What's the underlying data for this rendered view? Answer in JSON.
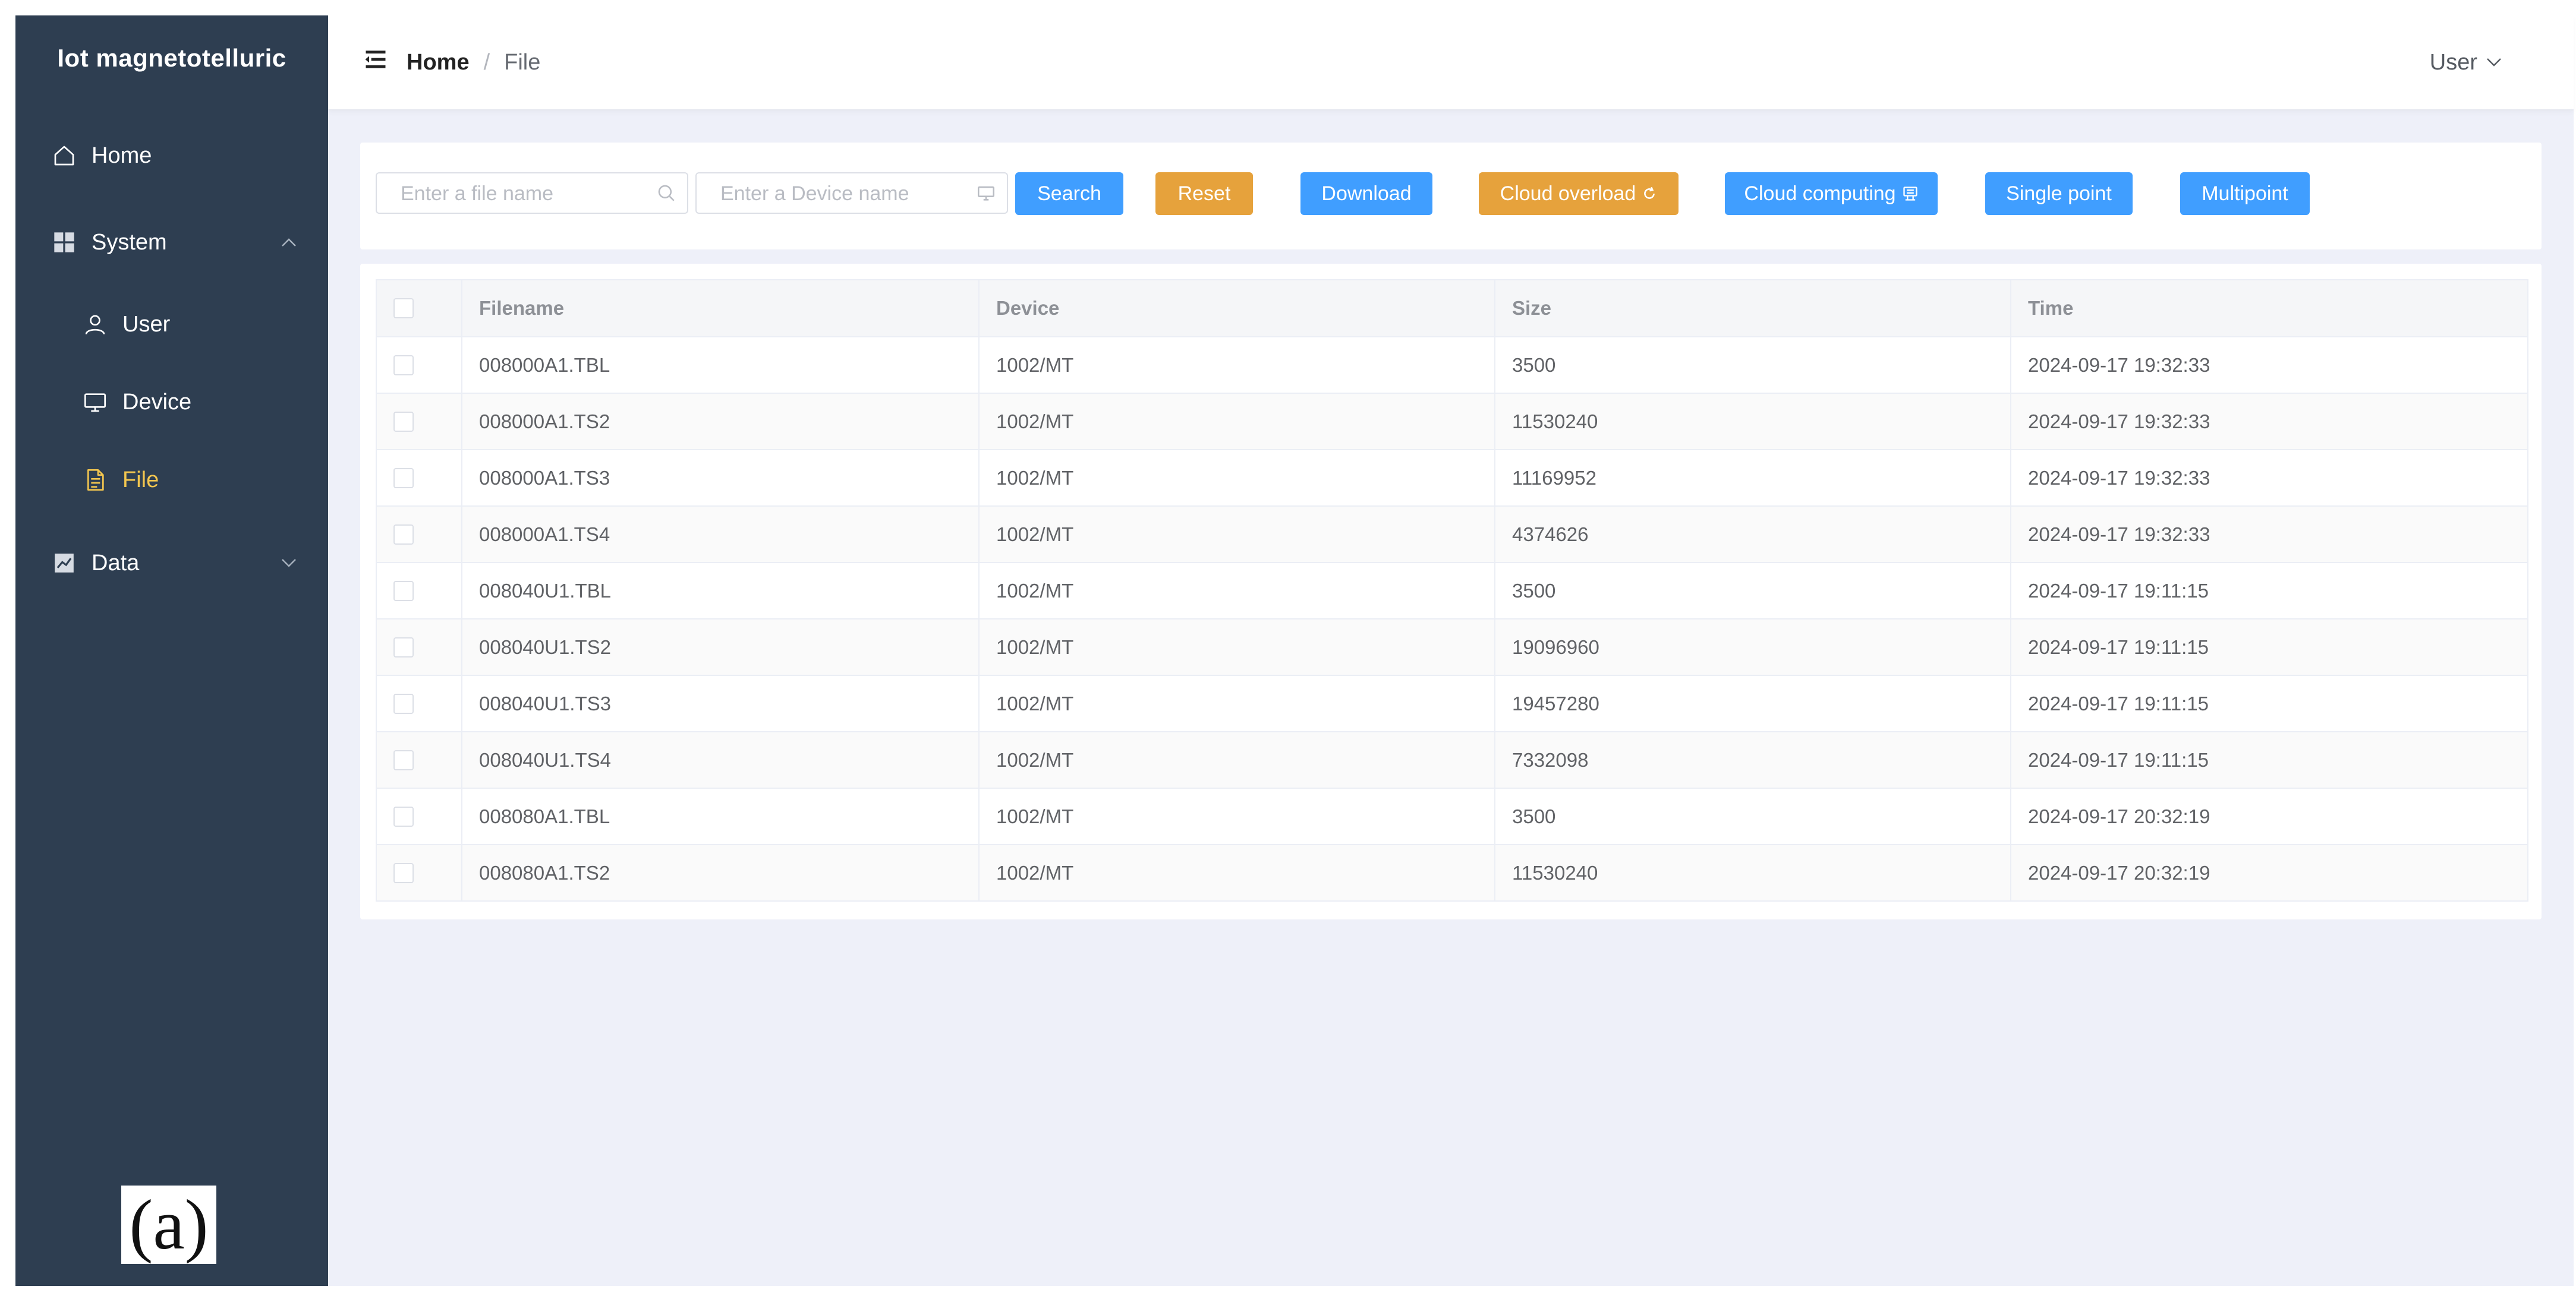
{
  "app": {
    "title": "Iot magnetotelluric"
  },
  "sidebar": {
    "items": [
      {
        "label": "Home",
        "icon": "home-icon"
      },
      {
        "label": "System",
        "icon": "grid-icon",
        "expanded": true
      },
      {
        "label": "User",
        "icon": "user-icon"
      },
      {
        "label": "Device",
        "icon": "monitor-icon"
      },
      {
        "label": "File",
        "icon": "document-icon",
        "active": true
      },
      {
        "label": "Data",
        "icon": "chart-icon",
        "expanded": false
      }
    ],
    "figure_label": "(a)"
  },
  "header": {
    "breadcrumb": {
      "home": "Home",
      "separator": "/",
      "current": "File"
    },
    "user_menu": "User"
  },
  "toolbar": {
    "file_input_placeholder": "Enter a file name",
    "device_input_placeholder": "Enter a Device name",
    "search_label": "Search",
    "reset_label": "Reset",
    "download_label": "Download",
    "cloud_overload_label": "Cloud overload",
    "cloud_computing_label": "Cloud computing",
    "single_point_label": "Single point",
    "multipoint_label": "Multipoint"
  },
  "table": {
    "columns": [
      "Filename",
      "Device",
      "Size",
      "Time"
    ],
    "rows": [
      {
        "filename": "008000A1.TBL",
        "device": "1002/MT",
        "size": "3500",
        "time": "2024-09-17 19:32:33"
      },
      {
        "filename": "008000A1.TS2",
        "device": "1002/MT",
        "size": "11530240",
        "time": "2024-09-17 19:32:33"
      },
      {
        "filename": "008000A1.TS3",
        "device": "1002/MT",
        "size": "11169952",
        "time": "2024-09-17 19:32:33"
      },
      {
        "filename": "008000A1.TS4",
        "device": "1002/MT",
        "size": "4374626",
        "time": "2024-09-17 19:32:33"
      },
      {
        "filename": "008040U1.TBL",
        "device": "1002/MT",
        "size": "3500",
        "time": "2024-09-17 19:11:15"
      },
      {
        "filename": "008040U1.TS2",
        "device": "1002/MT",
        "size": "19096960",
        "time": "2024-09-17 19:11:15"
      },
      {
        "filename": "008040U1.TS3",
        "device": "1002/MT",
        "size": "19457280",
        "time": "2024-09-17 19:11:15"
      },
      {
        "filename": "008040U1.TS4",
        "device": "1002/MT",
        "size": "7332098",
        "time": "2024-09-17 19:11:15"
      },
      {
        "filename": "008080A1.TBL",
        "device": "1002/MT",
        "size": "3500",
        "time": "2024-09-17 20:32:19"
      },
      {
        "filename": "008080A1.TS2",
        "device": "1002/MT",
        "size": "11530240",
        "time": "2024-09-17 20:32:19"
      }
    ]
  },
  "colors": {
    "sidebar_bg": "#2e3e51",
    "active": "#f3c64f",
    "primary": "#409eff",
    "warning": "#e6a23c",
    "page_bg": "#eef0f9"
  }
}
